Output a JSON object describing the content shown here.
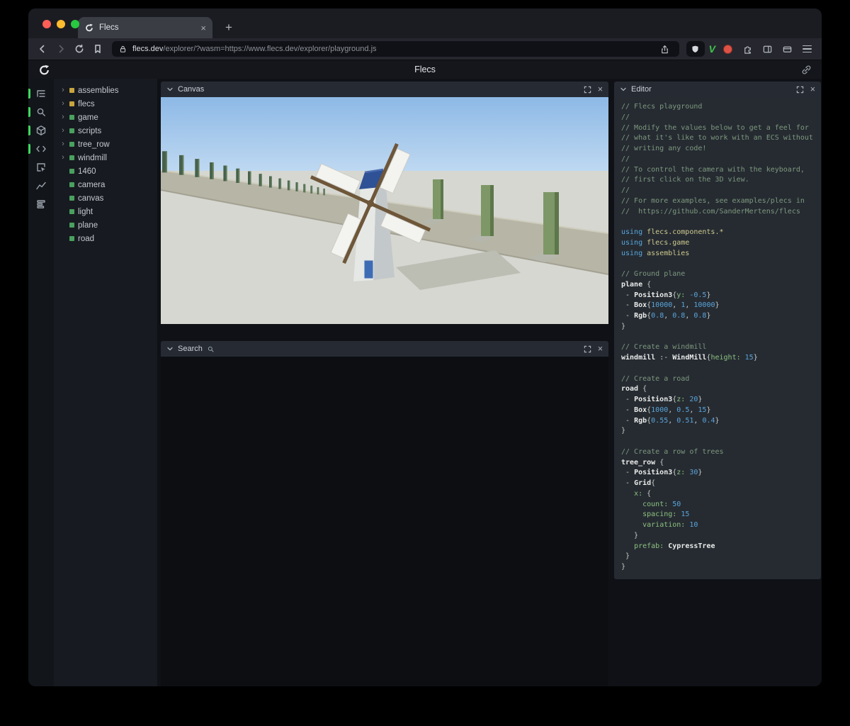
{
  "browser": {
    "tab_title": "Flecs",
    "url_domain": "flecs.dev",
    "url_path": "/explorer/?wasm=https://www.flecs.dev/explorer/playground.js",
    "v_label": "V"
  },
  "header": {
    "title": "Flecs"
  },
  "rail": {
    "items": [
      {
        "name": "entity-tree",
        "active": true
      },
      {
        "name": "search",
        "active": true
      },
      {
        "name": "canvas-3d",
        "active": true
      },
      {
        "name": "code-editor",
        "active": true
      },
      {
        "name": "inspector",
        "active": false
      },
      {
        "name": "stats-chart",
        "active": false
      },
      {
        "name": "queries-list",
        "active": false
      }
    ]
  },
  "tree": {
    "items": [
      {
        "label": "assemblies",
        "color": "yellow",
        "expandable": true
      },
      {
        "label": "flecs",
        "color": "yellow",
        "expandable": true
      },
      {
        "label": "game",
        "color": "green",
        "expandable": true
      },
      {
        "label": "scripts",
        "color": "green",
        "expandable": true
      },
      {
        "label": "tree_row",
        "color": "green",
        "expandable": true
      },
      {
        "label": "windmill",
        "color": "green",
        "expandable": true
      },
      {
        "label": "1460",
        "color": "green",
        "expandable": false
      },
      {
        "label": "camera",
        "color": "green",
        "expandable": false
      },
      {
        "label": "canvas",
        "color": "green",
        "expandable": false
      },
      {
        "label": "light",
        "color": "green",
        "expandable": false
      },
      {
        "label": "plane",
        "color": "green",
        "expandable": false
      },
      {
        "label": "road",
        "color": "green",
        "expandable": false
      }
    ]
  },
  "panels": {
    "canvas": {
      "title": "Canvas"
    },
    "search": {
      "title": "Search"
    },
    "editor": {
      "title": "Editor"
    }
  },
  "editor": {
    "lines": [
      [
        [
          "c",
          "// Flecs playground"
        ]
      ],
      [
        [
          "c",
          "//"
        ]
      ],
      [
        [
          "c",
          "// Modify the values below to get a feel for"
        ]
      ],
      [
        [
          "c",
          "// what it's like to work with an ECS without"
        ]
      ],
      [
        [
          "c",
          "// writing any code!"
        ]
      ],
      [
        [
          "c",
          "//"
        ]
      ],
      [
        [
          "c",
          "// To control the camera with the keyboard,"
        ]
      ],
      [
        [
          "c",
          "// first click on the 3D view."
        ]
      ],
      [
        [
          "c",
          "//"
        ]
      ],
      [
        [
          "c",
          "// For more examples, see examples/plecs in"
        ]
      ],
      [
        [
          "c",
          "//  https://github.com/SanderMertens/flecs"
        ]
      ],
      [],
      [
        [
          "k",
          "using "
        ],
        [
          "m",
          "flecs.components.*"
        ]
      ],
      [
        [
          "k",
          "using "
        ],
        [
          "m",
          "flecs.game"
        ]
      ],
      [
        [
          "k",
          "using "
        ],
        [
          "m",
          "assemblies"
        ]
      ],
      [],
      [
        [
          "c",
          "// Ground plane"
        ]
      ],
      [
        [
          "t",
          "plane"
        ],
        [
          "d",
          " {"
        ]
      ],
      [
        [
          "d",
          " - "
        ],
        [
          "t",
          "Position3"
        ],
        [
          "d",
          "{"
        ],
        [
          "p",
          "y:"
        ],
        [
          "d",
          " "
        ],
        [
          "n",
          "-0.5"
        ],
        [
          "d",
          "}"
        ]
      ],
      [
        [
          "d",
          " - "
        ],
        [
          "t",
          "Box"
        ],
        [
          "d",
          "{"
        ],
        [
          "n",
          "10000"
        ],
        [
          "d",
          ", "
        ],
        [
          "n",
          "1"
        ],
        [
          "d",
          ", "
        ],
        [
          "n",
          "10000"
        ],
        [
          "d",
          "}"
        ]
      ],
      [
        [
          "d",
          " - "
        ],
        [
          "t",
          "Rgb"
        ],
        [
          "d",
          "{"
        ],
        [
          "n",
          "0.8"
        ],
        [
          "d",
          ", "
        ],
        [
          "n",
          "0.8"
        ],
        [
          "d",
          ", "
        ],
        [
          "n",
          "0.8"
        ],
        [
          "d",
          "}"
        ]
      ],
      [
        [
          "d",
          "}"
        ]
      ],
      [],
      [
        [
          "c",
          "// Create a windmill"
        ]
      ],
      [
        [
          "t",
          "windmill"
        ],
        [
          "d",
          " :- "
        ],
        [
          "t",
          "WindMill"
        ],
        [
          "d",
          "{"
        ],
        [
          "p",
          "height:"
        ],
        [
          "d",
          " "
        ],
        [
          "n",
          "15"
        ],
        [
          "d",
          "}"
        ]
      ],
      [],
      [
        [
          "c",
          "// Create a road"
        ]
      ],
      [
        [
          "t",
          "road"
        ],
        [
          "d",
          " {"
        ]
      ],
      [
        [
          "d",
          " - "
        ],
        [
          "t",
          "Position3"
        ],
        [
          "d",
          "{"
        ],
        [
          "p",
          "z:"
        ],
        [
          "d",
          " "
        ],
        [
          "n",
          "20"
        ],
        [
          "d",
          "}"
        ]
      ],
      [
        [
          "d",
          " - "
        ],
        [
          "t",
          "Box"
        ],
        [
          "d",
          "{"
        ],
        [
          "n",
          "1000"
        ],
        [
          "d",
          ", "
        ],
        [
          "n",
          "0.5"
        ],
        [
          "d",
          ", "
        ],
        [
          "n",
          "15"
        ],
        [
          "d",
          "}"
        ]
      ],
      [
        [
          "d",
          " - "
        ],
        [
          "t",
          "Rgb"
        ],
        [
          "d",
          "{"
        ],
        [
          "n",
          "0.55"
        ],
        [
          "d",
          ", "
        ],
        [
          "n",
          "0.51"
        ],
        [
          "d",
          ", "
        ],
        [
          "n",
          "0.4"
        ],
        [
          "d",
          "}"
        ]
      ],
      [
        [
          "d",
          "}"
        ]
      ],
      [],
      [
        [
          "c",
          "// Create a row of trees"
        ]
      ],
      [
        [
          "t",
          "tree_row"
        ],
        [
          "d",
          " {"
        ]
      ],
      [
        [
          "d",
          " - "
        ],
        [
          "t",
          "Position3"
        ],
        [
          "d",
          "{"
        ],
        [
          "p",
          "z:"
        ],
        [
          "d",
          " "
        ],
        [
          "n",
          "30"
        ],
        [
          "d",
          "}"
        ]
      ],
      [
        [
          "d",
          " - "
        ],
        [
          "t",
          "Grid"
        ],
        [
          "d",
          "{"
        ]
      ],
      [
        [
          "d",
          "   "
        ],
        [
          "p",
          "x:"
        ],
        [
          "d",
          " {"
        ]
      ],
      [
        [
          "d",
          "     "
        ],
        [
          "p",
          "count:"
        ],
        [
          "d",
          " "
        ],
        [
          "n",
          "50"
        ]
      ],
      [
        [
          "d",
          "     "
        ],
        [
          "p",
          "spacing:"
        ],
        [
          "d",
          " "
        ],
        [
          "n",
          "15"
        ]
      ],
      [
        [
          "d",
          "     "
        ],
        [
          "p",
          "variation:"
        ],
        [
          "d",
          " "
        ],
        [
          "n",
          "10"
        ]
      ],
      [
        [
          "d",
          "   }"
        ]
      ],
      [
        [
          "d",
          "   "
        ],
        [
          "p",
          "prefab:"
        ],
        [
          "d",
          " "
        ],
        [
          "t",
          "CypressTree"
        ]
      ],
      [
        [
          "d",
          " }"
        ]
      ],
      [
        [
          "d",
          "}"
        ]
      ]
    ]
  },
  "scene": {
    "description": "3D view: windmill with white sails, road receding left with row of cypress trees, green box trees right, blue sky, gray ground",
    "cypress_count": 16,
    "sky_top": "#8db9e6",
    "sky_bottom": "#bed8f1",
    "ground": "#d6d7d1",
    "road": "#b7b5a5",
    "cypress_color": "#46604b",
    "tree_face": "#7e9766",
    "tree_side": "#5d774b",
    "windmill_sail": "#f3f3ef",
    "windmill_roof": "#2f5195",
    "blade_arm": "#6e5639"
  },
  "colors": {
    "accent_green": "#3fd95f",
    "entity_yellow": "#c9a53f",
    "entity_green": "#4aa05f",
    "syn_comment": "#7d987d",
    "syn_keyword": "#58a7de",
    "syn_module": "#cdc98c",
    "syn_type": "#e9ebe9",
    "syn_prop": "#8cc17f",
    "syn_number": "#5aa5da",
    "syn_plain": "#c6cac6",
    "traffic_red": "#ff5f57",
    "traffic_yellow": "#febc2e",
    "traffic_green": "#28c840",
    "brave_v_green": "#3fc24f"
  }
}
